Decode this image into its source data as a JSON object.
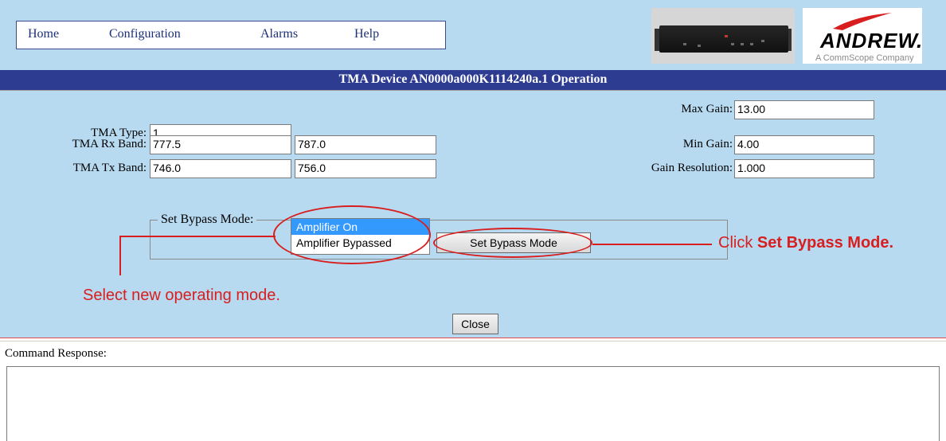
{
  "menu": {
    "items": [
      "Home",
      "Configuration",
      "Alarms",
      "Help"
    ]
  },
  "logo": {
    "name": "ANDREW.",
    "subtitle": "A CommScope Company"
  },
  "page_title": "TMA Device AN0000a000K1114240a.1 Operation",
  "fields": {
    "tma_type": {
      "label": "TMA Type:",
      "value": "1"
    },
    "tma_rx_band": {
      "label": "TMA Rx Band:",
      "value_low": "777.5",
      "value_high": "787.0"
    },
    "tma_tx_band": {
      "label": "TMA Tx Band:",
      "value_low": "746.0",
      "value_high": "756.0"
    },
    "max_gain": {
      "label": "Max Gain:",
      "value": "13.00"
    },
    "min_gain": {
      "label": "Min Gain:",
      "value": "4.00"
    },
    "gain_resolution": {
      "label": "Gain Resolution:",
      "value": "1.000"
    }
  },
  "bypass": {
    "legend": "Set Bypass Mode:",
    "options": [
      "Amplifier On",
      "Amplifier Bypassed"
    ],
    "selected": "Amplifier On",
    "button_label": "Set Bypass Mode"
  },
  "annotations": {
    "select_mode": "Select new operating mode.",
    "click_prefix": "Click ",
    "click_bold": "Set Bypass Mode."
  },
  "close_label": "Close",
  "command_response": {
    "label": "Command Response:",
    "text": ""
  },
  "colors": {
    "panel": "#b7daf0",
    "title_bar": "#2d3c91",
    "annotation_red": "#d81e1e",
    "selected_option": "#3399ff"
  }
}
